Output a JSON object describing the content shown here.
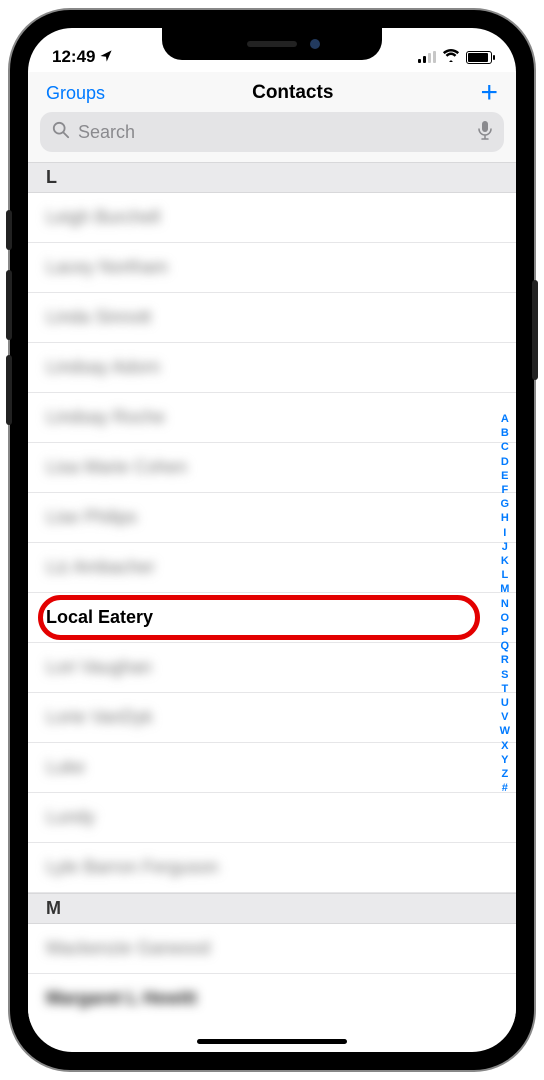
{
  "status": {
    "time": "12:49"
  },
  "nav": {
    "left": "Groups",
    "title": "Contacts",
    "add": "+"
  },
  "search": {
    "placeholder": "Search"
  },
  "sections": {
    "L": {
      "header": "L",
      "rows": [
        {
          "text": "Leigh Burchell",
          "blurred": true
        },
        {
          "text": "Lacey Northam",
          "blurred": true
        },
        {
          "text": "Linda Sinnott",
          "blurred": true
        },
        {
          "text": "Lindsay Adorn",
          "blurred": true
        },
        {
          "text": "Lindsay Roche",
          "blurred": true
        },
        {
          "text": "Lisa Marie Cohen",
          "blurred": true
        },
        {
          "text": "Lise Philips",
          "blurred": true
        },
        {
          "text": "Liz Ambacher",
          "blurred": true
        },
        {
          "text": "Local Eatery",
          "blurred": false,
          "highlighted": true
        },
        {
          "text": "Lori Vaughan",
          "blurred": true
        },
        {
          "text": "Lorie VanDyk",
          "blurred": true
        },
        {
          "text": "Luke",
          "blurred": true
        },
        {
          "text": "Lundy",
          "blurred": true
        },
        {
          "text": "Lyle Barron Ferguson",
          "blurred": true
        }
      ]
    },
    "M": {
      "header": "M",
      "rows": [
        {
          "text": "Mackenzie Garwood",
          "blurred": true
        },
        {
          "text": "Margaret L Hewitt",
          "blurred": true,
          "dark": true
        }
      ]
    }
  },
  "index": [
    "A",
    "B",
    "C",
    "D",
    "E",
    "F",
    "G",
    "H",
    "I",
    "J",
    "K",
    "L",
    "M",
    "N",
    "O",
    "P",
    "Q",
    "R",
    "S",
    "T",
    "U",
    "V",
    "W",
    "X",
    "Y",
    "Z",
    "#"
  ]
}
